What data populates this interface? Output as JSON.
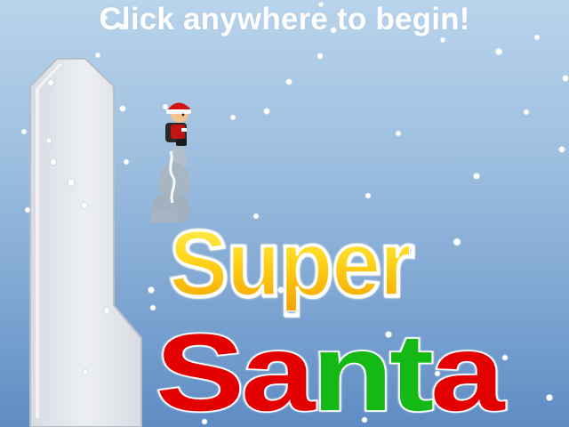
{
  "prompt_text": "Click anywhere to begin!",
  "logo": {
    "line1": "Super",
    "line2_letters": [
      {
        "char": "S",
        "color": "red"
      },
      {
        "char": "a",
        "color": "red"
      },
      {
        "char": "n",
        "color": "green"
      },
      {
        "char": "t",
        "color": "green"
      },
      {
        "char": "a",
        "color": "red"
      }
    ]
  },
  "colors": {
    "sky_top": "#b9d4ec",
    "sky_bottom": "#5e8cc3",
    "pillar": "#e4e7ec",
    "logo_yellow": "#ffd51c",
    "logo_red": "#e20000",
    "logo_green": "#15b915",
    "snow": "#ffffff"
  },
  "sprites": {
    "player": "santa-jetpack",
    "obstacle": "ice-pillar"
  }
}
